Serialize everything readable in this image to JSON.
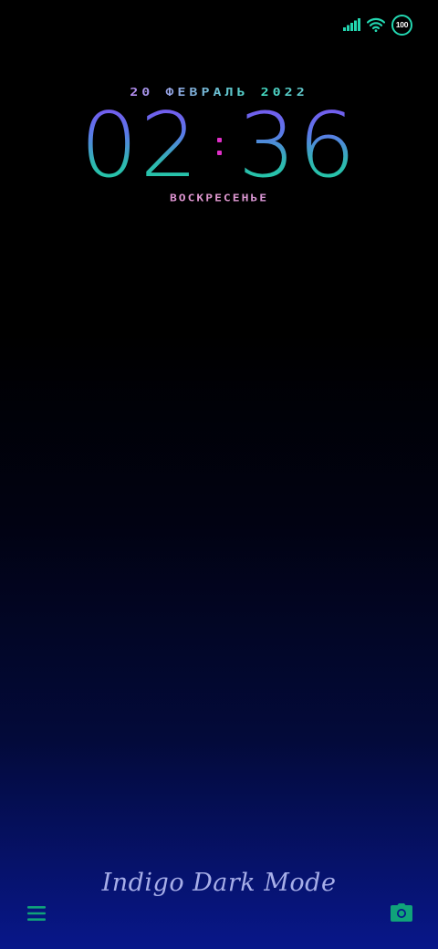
{
  "status_bar": {
    "battery_level": "100",
    "signal_icon": "signal-bars-icon",
    "wifi_icon": "wifi-icon",
    "accent_color": "#23d6b0"
  },
  "lockscreen": {
    "date": "20 ФЕВРАЛЬ 2022",
    "hours": "02",
    "minutes": "36",
    "weekday": "ВОСКРЕСЕНЬЕ"
  },
  "signature": "Indigo Dark Mode",
  "bottom_bar": {
    "left_icon": "menu-icon",
    "right_icon": "camera-icon",
    "icon_color": "#10a37a"
  },
  "colors": {
    "time_top": "#7a55f0",
    "time_bottom": "#1fcfa5",
    "separator": "#e02fc8",
    "background_bottom": "#08178a"
  }
}
